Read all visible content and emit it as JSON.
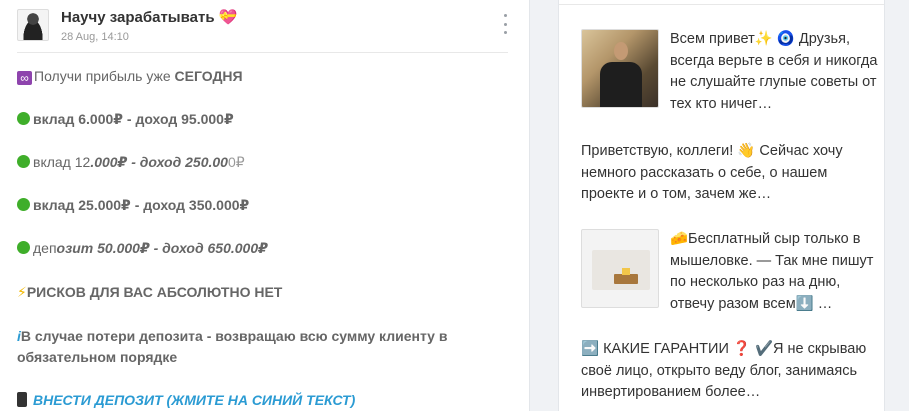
{
  "post": {
    "author": "Научу зарабатывать 💝",
    "date": "28 Aug, 14:10",
    "intro_emoji": "∞",
    "intro_text": "Получи прибыль уже ",
    "intro_bold": "СЕГОДНЯ",
    "line1": "вклад 6.000₽ - доход 95.000₽",
    "line2_normal": "вклад 12",
    "line2_italic": ".000₽ - доход 250.00",
    "line2_tail": "0₽",
    "line3": "вклад 25.000₽ - доход 350.000₽",
    "line4_normal": "деп",
    "line4_italic": "озит 50.000₽ - доход 650.000₽",
    "risk_emoji": "⚡",
    "risk_text": "РИСКОВ ДЛЯ ВАС АБСОЛЮТНО НЕТ",
    "refund_prefix": "i",
    "refund_text": "В случае потери депозита - возвращаю всю сумму клиенту в обязательном порядке",
    "deposit_link": "ВНЕСТИ ДЕПОЗИТ (ЖМИТЕ НА СИНИЙ ТЕКСТ)"
  },
  "sidebar": {
    "items": [
      {
        "text": "Всем привет✨ 🧿 Друзья, всегда верьте в себя и никогда не слушайте глупые советы от тех кто ничег…",
        "has_thumb": true
      },
      {
        "text": "Приветствую, коллеги! 👋 Сейчас хочу немного рассказать о себе, о нашем проекте и о том, зачем же…",
        "has_thumb": false
      },
      {
        "text": "🧀Бесплатный сыр только в мышеловке. — Так мне пишут по несколько раз на дню, отвечу разом всем⬇️ …",
        "has_thumb": true
      },
      {
        "text": "➡️ КАКИЕ ГАРАНТИИ ❓ ✔️Я не скрываю своё лицо, открыто веду блог, занимаясь инвертированием более…",
        "has_thumb": false
      }
    ]
  },
  "colors": {
    "link": "#2b9bd3",
    "bullet": "#3fae2a",
    "infinity_badge": "#8e44ad"
  }
}
